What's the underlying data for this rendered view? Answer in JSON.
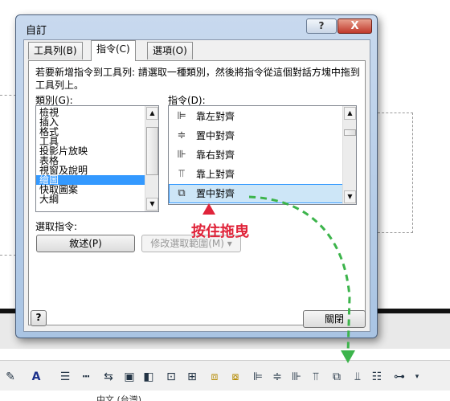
{
  "dialog": {
    "title": "自訂",
    "help_label": "?",
    "close_label": "X",
    "tabs": [
      {
        "label": "工具列(B)"
      },
      {
        "label": "指令(C)"
      },
      {
        "label": "選項(O)"
      }
    ],
    "instruction": "若要新增指令到工具列: 請選取一種類別，然後將指令從這個對話方塊中拖到工具列上。",
    "categories_label": "類別(G):",
    "commands_label": "指令(D):",
    "categories": [
      "檢視",
      "插入",
      "格式",
      "工具",
      "投影片放映",
      "表格",
      "視窗及說明",
      "繪圖",
      "快取圖案",
      "大綱"
    ],
    "selected_category": "繪圖",
    "commands": [
      {
        "label": "靠左對齊",
        "icon": "align-left-icon",
        "glyph": "⊫"
      },
      {
        "label": "置中對齊",
        "icon": "align-center-icon",
        "glyph": "≑"
      },
      {
        "label": "靠右對齊",
        "icon": "align-right-icon",
        "glyph": "⊪"
      },
      {
        "label": "靠上對齊",
        "icon": "align-top-icon",
        "glyph": "⫪"
      },
      {
        "label": "置中對齊",
        "icon": "align-middle-icon",
        "glyph": "⧉"
      }
    ],
    "selected_command": "置中對齊",
    "selection_label": "選取指令:",
    "describe_button": "敘述(P)",
    "modify_button": "修改選取範圍(M) ▾",
    "ok_button": "關閉"
  },
  "annotation": {
    "text": "按住拖曳",
    "color": "#e0243a",
    "curve_color": "#3cb44b"
  },
  "status": {
    "text": "中文 (台灣)"
  }
}
